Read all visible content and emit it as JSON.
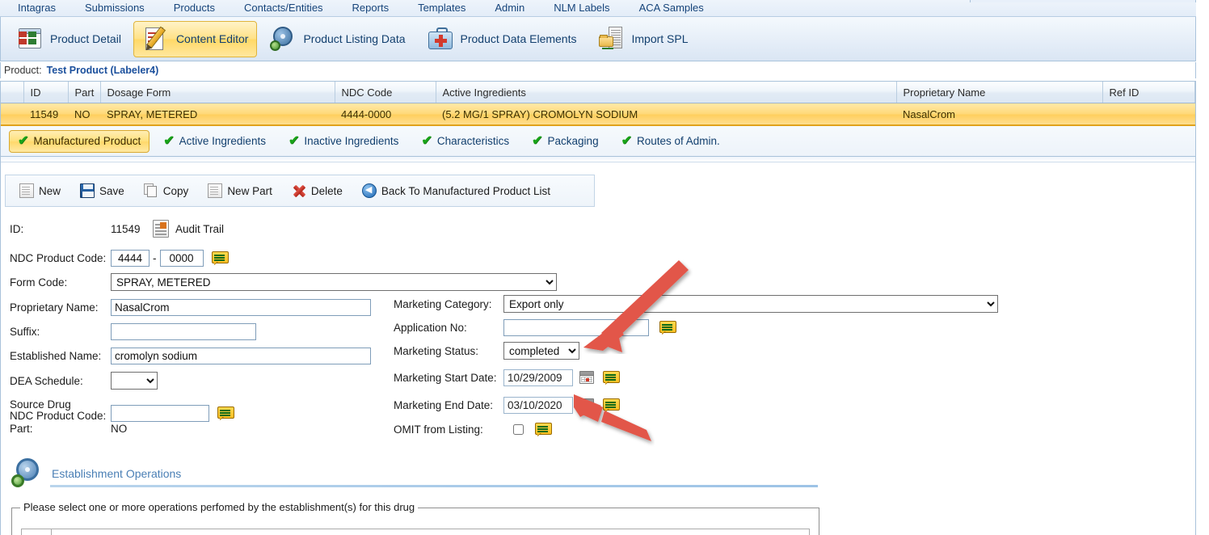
{
  "menu": {
    "items": [
      {
        "label": "Intagras"
      },
      {
        "label": "Submissions"
      },
      {
        "label": "Products"
      },
      {
        "label": "Contacts/Entities"
      },
      {
        "label": "Reports"
      },
      {
        "label": "Templates"
      },
      {
        "label": "Admin"
      },
      {
        "label": "NLM Labels"
      },
      {
        "label": "ACA Samples"
      }
    ]
  },
  "ribbon": {
    "items": [
      {
        "label": "Product Detail",
        "icon": "product-detail-icon",
        "active": false
      },
      {
        "label": "Content Editor",
        "icon": "content-editor-icon",
        "active": true
      },
      {
        "label": "Product Listing Data",
        "icon": "gear-icon",
        "active": false
      },
      {
        "label": "Product Data Elements",
        "icon": "medical-case-icon",
        "active": false
      },
      {
        "label": "Import SPL",
        "icon": "import-folder-icon",
        "active": false
      }
    ]
  },
  "product_line": {
    "label": "Product:",
    "value": "Test Product (Labeler4)"
  },
  "grid": {
    "columns": [
      "",
      "ID",
      "Part",
      "Dosage Form",
      "NDC Code",
      "Active Ingredients",
      "Proprietary Name",
      "Ref ID"
    ],
    "rows": [
      {
        "cells": [
          "",
          "11549",
          "NO",
          "SPRAY, METERED",
          "4444-0000",
          "(5.2 MG/1 SPRAY) CROMOLYN SODIUM",
          "NasalCrom",
          ""
        ],
        "selected": true
      }
    ]
  },
  "subtabs": {
    "items": [
      {
        "label": "Manufactured Product",
        "active": true
      },
      {
        "label": "Active Ingredients",
        "active": false
      },
      {
        "label": "Inactive Ingredients",
        "active": false
      },
      {
        "label": "Characteristics",
        "active": false
      },
      {
        "label": "Packaging",
        "active": false
      },
      {
        "label": "Routes of Admin.",
        "active": false
      }
    ]
  },
  "actionbar": {
    "items": [
      {
        "label": "New",
        "icon": "new-document-icon"
      },
      {
        "label": "Save",
        "icon": "floppy-disk-icon"
      },
      {
        "label": "Copy",
        "icon": "copy-pages-icon"
      },
      {
        "label": "New Part",
        "icon": "new-part-document-icon"
      },
      {
        "label": "Delete",
        "icon": "red-x-icon"
      },
      {
        "label": "Back To Manufactured Product List",
        "icon": "back-arrow-icon"
      }
    ]
  },
  "form": {
    "id_label": "ID:",
    "id_value": "11549",
    "audit_trail_label": "Audit Trail",
    "ndc_label": "NDC Product Code:",
    "ndc_part1": "4444",
    "ndc_sep": "-",
    "ndc_part2": "0000",
    "form_code_label": "Form Code:",
    "form_code_value": "SPRAY, METERED",
    "proprietary_label": "Proprietary Name:",
    "proprietary_value": "NasalCrom",
    "suffix_label": "Suffix:",
    "suffix_value": "",
    "established_label": "Established Name:",
    "established_value": "cromolyn sodium",
    "dea_label": "DEA Schedule:",
    "dea_value": "",
    "source_drug_label_l1": "Source Drug",
    "source_drug_label_l2": "NDC Product Code:",
    "source_drug_value": "",
    "part_label": "Part:",
    "part_value": "NO",
    "marketing_category_label": "Marketing Category:",
    "marketing_category_value": "Export only",
    "application_no_label": "Application No:",
    "application_no_value": "",
    "marketing_status_label": "Marketing Status:",
    "marketing_status_value": "completed",
    "marketing_start_label": "Marketing Start Date:",
    "marketing_start_value": "10/29/2009",
    "marketing_end_label": "Marketing End Date:",
    "marketing_end_value": "03/10/2020",
    "omit_label": "OMIT from Listing:",
    "omit_checked": false
  },
  "establishment": {
    "title": "Establishment Operations",
    "legend": "Please select one or more operations perfomed by the establishment(s) for this drug"
  },
  "annotations": {
    "arrow_color": "#e2574a",
    "arrows": [
      {
        "name": "arrow-to-marketing-status",
        "target": "marketing-status-select"
      },
      {
        "name": "arrow-to-marketing-end-date",
        "target": "marketing-end-date-field"
      }
    ]
  },
  "colors": {
    "selected_row": "#ffd878",
    "active_tab": "#ffe07b",
    "link": "#1a4f9c",
    "accent": "#4a7fb5"
  }
}
